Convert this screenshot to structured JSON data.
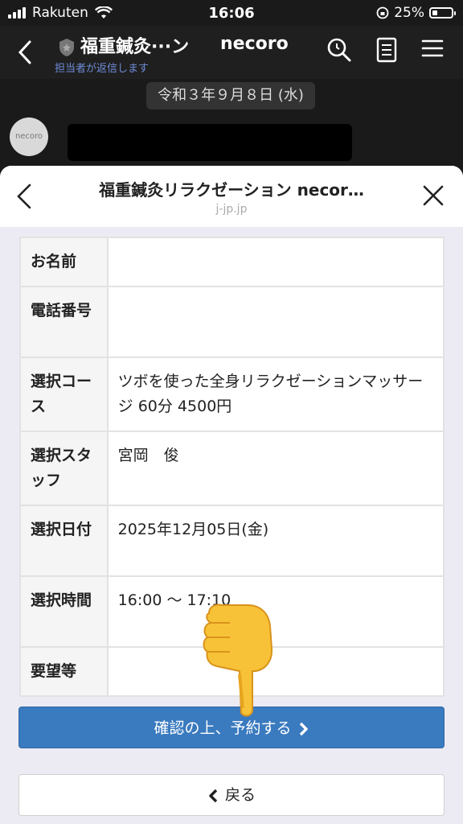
{
  "status_bar": {
    "carrier": "Rakuten",
    "time": "16:06",
    "battery": "25%"
  },
  "chat": {
    "title": "福重鍼灸···ン",
    "brand": "necoro",
    "subtitle": "担当者が返信します",
    "date": "令和３年９月８日 (水)",
    "avatar_text": "necoro"
  },
  "sheet": {
    "title": "福重鍼灸リラクゼーション necor…",
    "domain": "j-jp.jp"
  },
  "form": {
    "rows": [
      {
        "label": "お名前",
        "value": ""
      },
      {
        "label": "電話番号",
        "value": ""
      },
      {
        "label": "選択コース",
        "value": "ツボを使った全身リラクゼーションマッサージ 60分 4500円"
      },
      {
        "label": "選択スタッフ",
        "value": "宮岡　俊"
      },
      {
        "label": "選択日付",
        "value": "2025年12月05日(金)"
      },
      {
        "label": "選択時間",
        "value": "16:00 〜 17:10"
      },
      {
        "label": "要望等",
        "value": ""
      }
    ]
  },
  "buttons": {
    "confirm": "確認の上、予約する",
    "back": "戻る"
  },
  "colors": {
    "primary": "#3a7abf",
    "link": "#6e8dd8",
    "dark_bg": "#1a1a1a"
  }
}
